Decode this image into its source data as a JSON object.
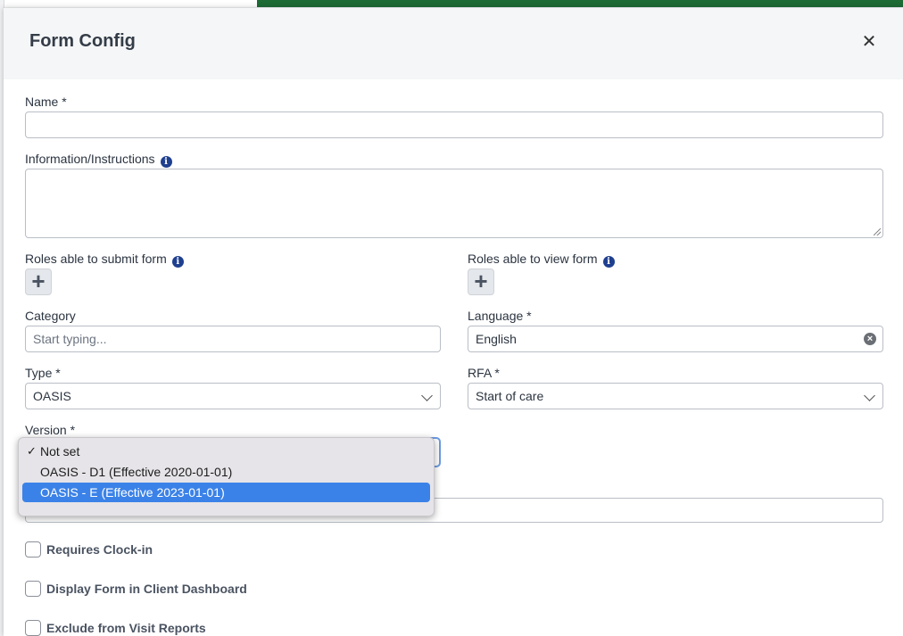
{
  "modal": {
    "title": "Form Config"
  },
  "fields": {
    "name": {
      "label": "Name *",
      "value": ""
    },
    "instructions": {
      "label": "Information/Instructions",
      "value": ""
    },
    "roles_submit": {
      "label": "Roles able to submit form"
    },
    "roles_view": {
      "label": "Roles able to view form"
    },
    "category": {
      "label": "Category",
      "placeholder": "Start typing..."
    },
    "language": {
      "label": "Language *",
      "value": "English"
    },
    "type": {
      "label": "Type *",
      "value": "OASIS"
    },
    "rfa": {
      "label": "RFA *",
      "value": "Start of care"
    },
    "version": {
      "label": "Version *",
      "options": [
        {
          "label": "Not set",
          "checked": true
        },
        {
          "label": "OASIS - D1 (Effective 2020-01-01)",
          "checked": false
        },
        {
          "label": "OASIS - E (Effective 2023-01-01)",
          "checked": false,
          "highlighted": true
        }
      ]
    }
  },
  "checkboxes": [
    {
      "label": "Requires Clock-in",
      "checked": false
    },
    {
      "label": "Display Form in Client Dashboard",
      "checked": false
    },
    {
      "label": "Exclude from Visit Reports",
      "checked": false
    }
  ],
  "icons": {
    "close": "close-icon",
    "info": "info-icon",
    "add": "plus-icon",
    "clear": "clear-icon",
    "check": "checkmark-icon"
  },
  "colors": {
    "accent": "#3b82e8",
    "info": "#1f3f8f",
    "header_bg": "#f5f6f7"
  }
}
